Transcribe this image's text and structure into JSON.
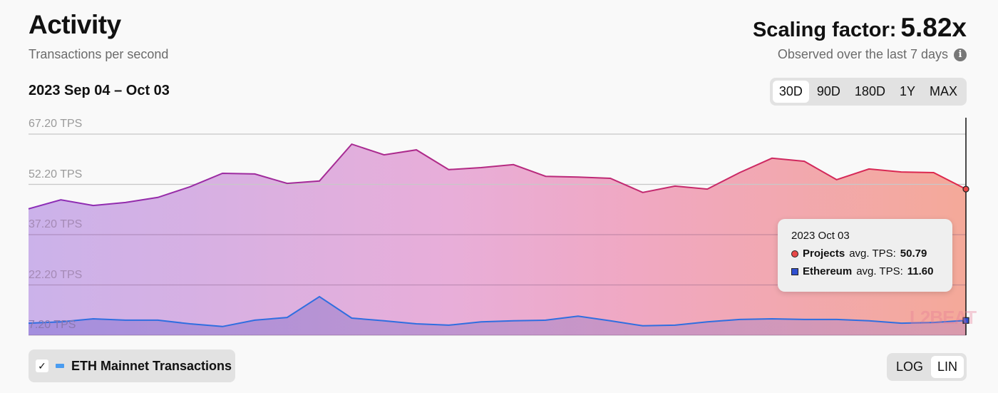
{
  "header": {
    "title": "Activity",
    "subtitle": "Transactions per second",
    "date_range": "2023 Sep 04 – Oct 03",
    "scaling_label": "Scaling factor:",
    "scaling_value": "5.82x",
    "observed": "Observed over the last 7 days",
    "info_icon": "info-icon"
  },
  "ranges": [
    {
      "label": "30D",
      "active": true
    },
    {
      "label": "90D"
    },
    {
      "label": "180D"
    },
    {
      "label": "1Y"
    },
    {
      "label": "MAX"
    }
  ],
  "scale": [
    {
      "label": "LOG"
    },
    {
      "label": "LIN",
      "active": true
    }
  ],
  "legend": {
    "checked": true,
    "label": "ETH Mainnet Transactions",
    "color": "#4a9cf0"
  },
  "tooltip": {
    "date": "2023 Oct 03",
    "projects_label": "Projects",
    "projects_suffix": "avg. TPS:",
    "projects_value": "50.79",
    "eth_label": "Ethereum",
    "eth_suffix": "avg. TPS:",
    "eth_value": "11.60"
  },
  "logo": "L2BEAT",
  "chart_data": {
    "type": "area",
    "x": [
      "2023-09-04",
      "2023-10-03"
    ],
    "x_count": 30,
    "ylim": [
      7.2,
      72
    ],
    "y_ticks": [
      "67.20 TPS",
      "52.20 TPS",
      "37.20 TPS",
      "22.20 TPS",
      "7.20 TPS"
    ],
    "y_tick_values": [
      67.2,
      52.2,
      37.2,
      22.2,
      7.2
    ],
    "grid": true,
    "series": [
      {
        "name": "Projects",
        "color_start": "#8a2cb8",
        "color_end": "#e0284a",
        "values": [
          44.9,
          47.6,
          45.9,
          46.8,
          48.3,
          51.5,
          55.5,
          55.3,
          52.5,
          53.2,
          64.2,
          61.0,
          62.5,
          56.6,
          57.2,
          58.1,
          54.6,
          54.4,
          54.0,
          49.8,
          51.7,
          50.8,
          55.7,
          60.0,
          59.1,
          53.6,
          56.8,
          55.9,
          55.7,
          50.79
        ]
      },
      {
        "name": "Ethereum",
        "color": "#2f6ee0",
        "values": [
          10.8,
          11.2,
          12.1,
          11.7,
          11.7,
          10.6,
          9.8,
          11.7,
          12.5,
          18.7,
          12.3,
          11.5,
          10.6,
          10.2,
          11.2,
          11.5,
          11.7,
          12.9,
          11.5,
          10.0,
          10.2,
          11.2,
          11.9,
          12.1,
          11.9,
          11.9,
          11.5,
          10.8,
          11.0,
          11.6
        ]
      }
    ]
  }
}
